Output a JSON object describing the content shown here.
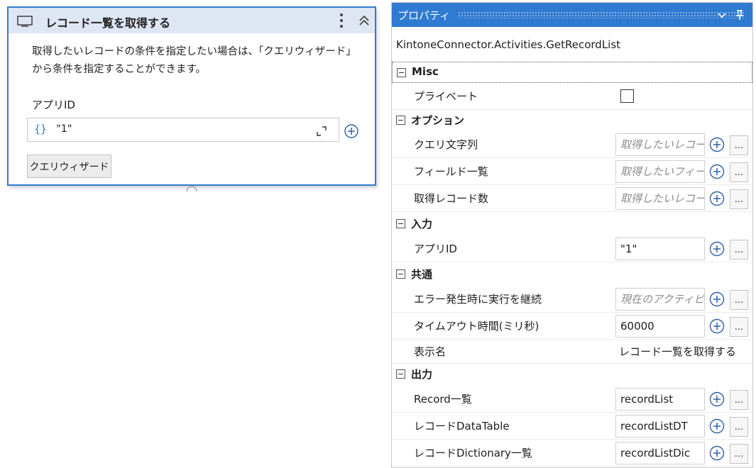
{
  "activity": {
    "title": "レコード一覧を取得する",
    "description": "取得したいレコードの条件を指定したい場合は、「クエリウィザード」から条件を指定することができます。",
    "app_id_label": "アプリID",
    "app_id_brace": "{}",
    "app_id_value": "\"1\"",
    "wizard_button": "クエリウィザード"
  },
  "properties": {
    "title": "プロパティ",
    "class_name": "KintoneConnector.Activities.GetRecordList",
    "categories": {
      "misc": "Misc",
      "options": "オプション",
      "input": "入力",
      "common": "共通",
      "output": "出力"
    },
    "rows": {
      "private": {
        "name": "プライベート",
        "checked": false
      },
      "query": {
        "name": "クエリ文字列",
        "placeholder": "取得したいレコー"
      },
      "fields": {
        "name": "フィールド一覧",
        "placeholder": "取得したいフィー"
      },
      "count": {
        "name": "取得レコード数",
        "placeholder": "取得したいレコー"
      },
      "app_id": {
        "name": "アプリID",
        "value": "\"1\""
      },
      "continue_on_error": {
        "name": "エラー発生時に実行を継続",
        "placeholder": "現在のアクティビ"
      },
      "timeout": {
        "name": "タイムアウト時間(ミリ秒)",
        "value": "60000"
      },
      "display_name": {
        "name": "表示名",
        "value": "レコード一覧を取得する"
      },
      "record_list": {
        "name": "Record一覧",
        "value": "recordList"
      },
      "record_datatable": {
        "name": "レコードDataTable",
        "value": "recordListDT"
      },
      "record_dictionary": {
        "name": "レコードDictionary一覧",
        "value": "recordListDic"
      }
    },
    "ellipsis": "..."
  },
  "colors": {
    "accent": "#2f7bd1",
    "header_bg": "#dde6f2"
  },
  "icons": {
    "activity": "window-icon",
    "menu": "kebab-icon",
    "collapse": "double-chevron-up-icon",
    "expand": "expand-icon",
    "add": "plus-circle-icon",
    "panel_menu": "chevron-down-icon",
    "pin": "pin-icon"
  }
}
